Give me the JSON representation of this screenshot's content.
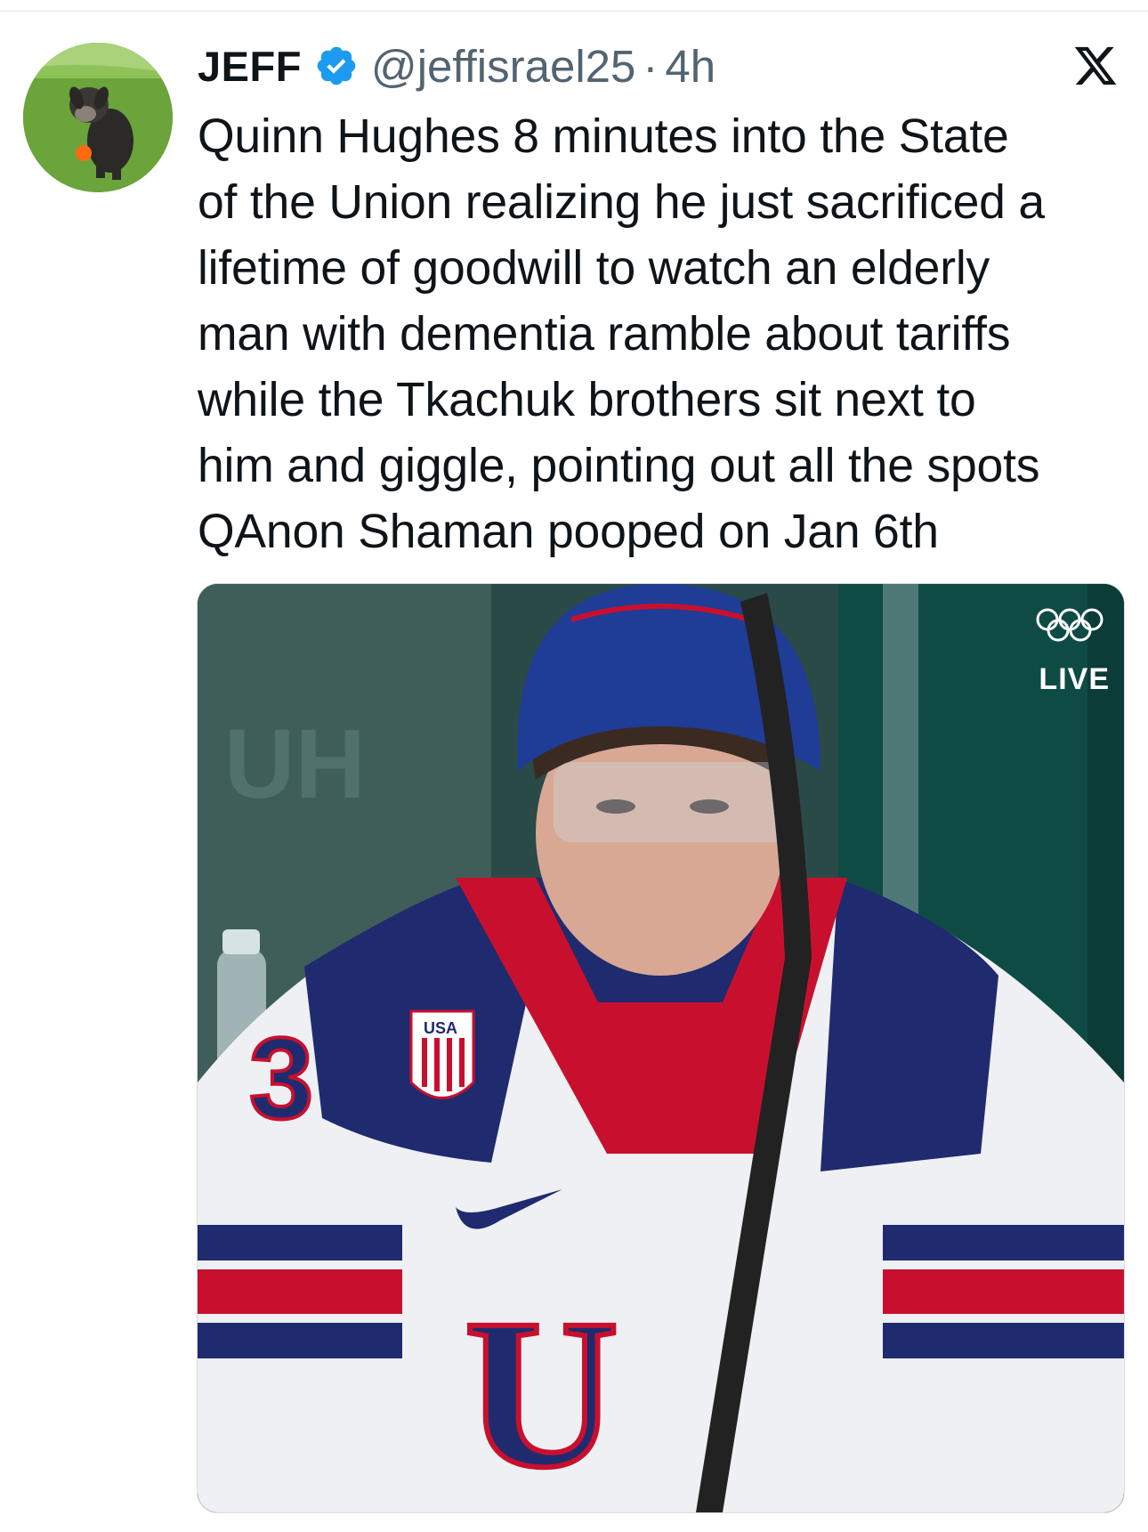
{
  "tweet": {
    "display_name": "JEFF",
    "handle": "@jeffisrael25",
    "separator": "·",
    "time": "4h",
    "text": "Quinn Hughes 8 minutes into the State\nof the Union realizing he just sacrificed a\nlifetime of goodwill to watch an elderly\nman with dementia ramble about tariffs\nwhile the Tkachuk brothers sit next to\nhim and giggle, pointing out all the spots\nQAnon Shaman pooped on Jan 6th",
    "verified_icon": "verified-badge-icon",
    "platform_icon": "x-logo-icon"
  },
  "media": {
    "live_label": "LIVE",
    "jersey_badge": "USA",
    "sleeve_number": "3",
    "jersey_front": "U",
    "wall_text": "UH",
    "icons": [
      "olympic-rings-icon",
      "nike-swoosh-icon"
    ]
  },
  "colors": {
    "verified_blue": "#1d9bf0",
    "handle_gray": "#536471",
    "text_black": "#0f1419",
    "usa_navy": "#1f2b6e",
    "usa_red": "#c8102e"
  }
}
